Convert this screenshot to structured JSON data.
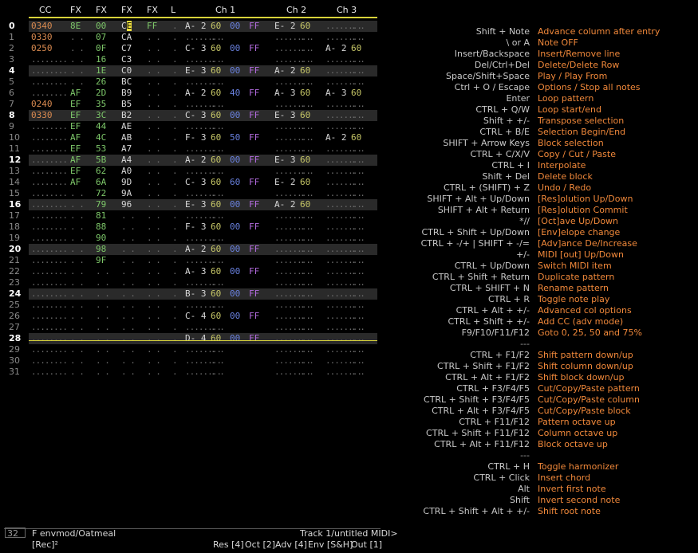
{
  "header": {
    "cc": "CC",
    "fx1": "FX",
    "fx2": "FX",
    "fx3": "FX",
    "fx4": "FX",
    "l": "L",
    "ch1": "Ch 1",
    "ch2": "Ch 2",
    "ch3": "Ch 3"
  },
  "rows": [
    {
      "n": "0",
      "bar": true,
      "cc": "0340",
      "f1": "8E",
      "f2": "00",
      "f3": "CE",
      "f4": "FF",
      "l": ".",
      "n1": "A- 2",
      "v1": "60",
      "p1": "00",
      "d1": "FF",
      "n2": "E- 2",
      "v2": "60",
      "n3": "",
      "v3": ""
    },
    {
      "n": "1",
      "bar": false,
      "cc": "0330",
      "f1": "",
      "f2": "07",
      "f3": "CA",
      "f4": "",
      "l": ".",
      "n1": "",
      "v1": "",
      "p1": "",
      "d1": "",
      "n2": "",
      "v2": "",
      "n3": "",
      "v3": ""
    },
    {
      "n": "2",
      "bar": false,
      "cc": "0250",
      "f1": "",
      "f2": "0F",
      "f3": "C7",
      "f4": "",
      "l": ".",
      "n1": "C- 3",
      "v1": "60",
      "p1": "00",
      "d1": "FF",
      "n2": "",
      "v2": "",
      "n3": "A- 2",
      "v3": "60"
    },
    {
      "n": "3",
      "bar": false,
      "cc": "",
      "f1": "",
      "f2": "16",
      "f3": "C3",
      "f4": "",
      "l": ".",
      "n1": "",
      "v1": "",
      "p1": "",
      "d1": "",
      "n2": "",
      "v2": "",
      "n3": "",
      "v3": ""
    },
    {
      "n": "4",
      "bar": true,
      "cc": "",
      "f1": "",
      "f2": "1E",
      "f3": "C0",
      "f4": "",
      "l": ".",
      "n1": "E- 3",
      "v1": "60",
      "p1": "00",
      "d1": "FF",
      "n2": "A- 2",
      "v2": "60",
      "n3": "",
      "v3": ""
    },
    {
      "n": "5",
      "bar": false,
      "cc": "",
      "f1": "",
      "f2": "26",
      "f3": "BC",
      "f4": "",
      "l": ".",
      "n1": "",
      "v1": "",
      "p1": "",
      "d1": "",
      "n2": "",
      "v2": "",
      "n3": "",
      "v3": ""
    },
    {
      "n": "6",
      "bar": false,
      "cc": "",
      "f1": "AF",
      "f2": "2D",
      "f3": "B9",
      "f4": "",
      "l": ".",
      "n1": "A- 2",
      "v1": "60",
      "p1": "40",
      "d1": "FF",
      "n2": "A- 3",
      "v2": "60",
      "n3": "A- 3",
      "v3": "60"
    },
    {
      "n": "7",
      "bar": false,
      "cc": "0240",
      "f1": "EF",
      "f2": "35",
      "f3": "B5",
      "f4": "",
      "l": ".",
      "n1": "",
      "v1": "",
      "p1": "",
      "d1": "",
      "n2": "",
      "v2": "",
      "n3": "",
      "v3": ""
    },
    {
      "n": "8",
      "bar": true,
      "cc": "0330",
      "f1": "EF",
      "f2": "3C",
      "f3": "B2",
      "f4": "",
      "l": ".",
      "n1": "C- 3",
      "v1": "60",
      "p1": "00",
      "d1": "FF",
      "n2": "E- 3",
      "v2": "60",
      "n3": "",
      "v3": ""
    },
    {
      "n": "9",
      "bar": false,
      "cc": "",
      "f1": "EF",
      "f2": "44",
      "f3": "AE",
      "f4": "",
      "l": ".",
      "n1": "",
      "v1": "",
      "p1": "",
      "d1": "",
      "n2": "",
      "v2": "",
      "n3": "",
      "v3": ""
    },
    {
      "n": "10",
      "bar": false,
      "cc": "",
      "f1": "AF",
      "f2": "4C",
      "f3": "AB",
      "f4": "",
      "l": ".",
      "n1": "F- 3",
      "v1": "60",
      "p1": "50",
      "d1": "FF",
      "n2": "",
      "v2": "",
      "n3": "A- 2",
      "v3": "60"
    },
    {
      "n": "11",
      "bar": false,
      "cc": "",
      "f1": "EF",
      "f2": "53",
      "f3": "A7",
      "f4": "",
      "l": ".",
      "n1": "",
      "v1": "",
      "p1": "",
      "d1": "",
      "n2": "",
      "v2": "",
      "n3": "",
      "v3": ""
    },
    {
      "n": "12",
      "bar": true,
      "cc": "",
      "f1": "AF",
      "f2": "5B",
      "f3": "A4",
      "f4": "",
      "l": ".",
      "n1": "A- 2",
      "v1": "60",
      "p1": "00",
      "d1": "FF",
      "n2": "E- 3",
      "v2": "60",
      "n3": "",
      "v3": ""
    },
    {
      "n": "13",
      "bar": false,
      "cc": "",
      "f1": "EF",
      "f2": "62",
      "f3": "A0",
      "f4": "",
      "l": ".",
      "n1": "",
      "v1": "",
      "p1": "",
      "d1": "",
      "n2": "",
      "v2": "",
      "n3": "",
      "v3": ""
    },
    {
      "n": "14",
      "bar": false,
      "cc": "",
      "f1": "AF",
      "f2": "6A",
      "f3": "9D",
      "f4": "",
      "l": ".",
      "n1": "C- 3",
      "v1": "60",
      "p1": "60",
      "d1": "FF",
      "n2": "E- 2",
      "v2": "60",
      "n3": "",
      "v3": ""
    },
    {
      "n": "15",
      "bar": false,
      "cc": "",
      "f1": "",
      "f2": "72",
      "f3": "9A",
      "f4": "",
      "l": ".",
      "n1": "",
      "v1": "",
      "p1": "",
      "d1": "",
      "n2": "",
      "v2": "",
      "n3": "",
      "v3": ""
    },
    {
      "n": "16",
      "bar": true,
      "cc": "",
      "f1": "",
      "f2": "79",
      "f3": "96",
      "f4": "",
      "l": ".",
      "n1": "E- 3",
      "v1": "60",
      "p1": "00",
      "d1": "FF",
      "n2": "A- 2",
      "v2": "60",
      "n3": "",
      "v3": ""
    },
    {
      "n": "17",
      "bar": false,
      "cc": "",
      "f1": "",
      "f2": "81",
      "f3": "",
      "f4": "",
      "l": ".",
      "n1": "",
      "v1": "",
      "p1": "",
      "d1": "",
      "n2": "",
      "v2": "",
      "n3": "",
      "v3": ""
    },
    {
      "n": "18",
      "bar": false,
      "cc": "",
      "f1": "",
      "f2": "88",
      "f3": "",
      "f4": "",
      "l": ".",
      "n1": "F- 3",
      "v1": "60",
      "p1": "00",
      "d1": "FF",
      "n2": "",
      "v2": "",
      "n3": "",
      "v3": ""
    },
    {
      "n": "19",
      "bar": false,
      "cc": "",
      "f1": "",
      "f2": "90",
      "f3": "",
      "f4": "",
      "l": ".",
      "n1": "",
      "v1": "",
      "p1": "",
      "d1": "",
      "n2": "",
      "v2": "",
      "n3": "",
      "v3": ""
    },
    {
      "n": "20",
      "bar": true,
      "cc": "",
      "f1": "",
      "f2": "98",
      "f3": "",
      "f4": "",
      "l": ".",
      "n1": "A- 2",
      "v1": "60",
      "p1": "00",
      "d1": "FF",
      "n2": "",
      "v2": "",
      "n3": "",
      "v3": ""
    },
    {
      "n": "21",
      "bar": false,
      "cc": "",
      "f1": "",
      "f2": "9F",
      "f3": "",
      "f4": "",
      "l": ".",
      "n1": "",
      "v1": "",
      "p1": "",
      "d1": "",
      "n2": "",
      "v2": "",
      "n3": "",
      "v3": ""
    },
    {
      "n": "22",
      "bar": false,
      "cc": "",
      "f1": "",
      "f2": "",
      "f3": "",
      "f4": "",
      "l": ".",
      "n1": "A- 3",
      "v1": "60",
      "p1": "00",
      "d1": "FF",
      "n2": "",
      "v2": "",
      "n3": "",
      "v3": ""
    },
    {
      "n": "23",
      "bar": false,
      "cc": "",
      "f1": "",
      "f2": "",
      "f3": "",
      "f4": "",
      "l": ".",
      "n1": "",
      "v1": "",
      "p1": "",
      "d1": "",
      "n2": "",
      "v2": "",
      "n3": "",
      "v3": ""
    },
    {
      "n": "24",
      "bar": true,
      "cc": "",
      "f1": "",
      "f2": "",
      "f3": "",
      "f4": "",
      "l": ".",
      "n1": "B- 3",
      "v1": "60",
      "p1": "00",
      "d1": "FF",
      "n2": "",
      "v2": "",
      "n3": "",
      "v3": ""
    },
    {
      "n": "25",
      "bar": false,
      "cc": "",
      "f1": "",
      "f2": "",
      "f3": "",
      "f4": "",
      "l": ".",
      "n1": "",
      "v1": "",
      "p1": "",
      "d1": "",
      "n2": "",
      "v2": "",
      "n3": "",
      "v3": ""
    },
    {
      "n": "26",
      "bar": false,
      "cc": "",
      "f1": "",
      "f2": "",
      "f3": "",
      "f4": "",
      "l": ".",
      "n1": "C- 4",
      "v1": "60",
      "p1": "00",
      "d1": "FF",
      "n2": "",
      "v2": "",
      "n3": "",
      "v3": ""
    },
    {
      "n": "27",
      "bar": false,
      "cc": "",
      "f1": "",
      "f2": "",
      "f3": "",
      "f4": "",
      "l": ".",
      "n1": "",
      "v1": "",
      "p1": "",
      "d1": "",
      "n2": "",
      "v2": "",
      "n3": "",
      "v3": ""
    },
    {
      "n": "28",
      "bar": true,
      "cc": "",
      "f1": "",
      "f2": "",
      "f3": "",
      "f4": "",
      "l": ".",
      "n1": "D- 4",
      "v1": "60",
      "p1": "00",
      "d1": "FF",
      "n2": "",
      "v2": "",
      "n3": "",
      "v3": ""
    },
    {
      "n": "29",
      "bar": false,
      "cc": "",
      "f1": "",
      "f2": "",
      "f3": "",
      "f4": "",
      "l": ".",
      "n1": "",
      "v1": "",
      "p1": "",
      "d1": "",
      "n2": "",
      "v2": "",
      "n3": "",
      "v3": ""
    },
    {
      "n": "30",
      "bar": false,
      "cc": "",
      "f1": "",
      "f2": "",
      "f3": "",
      "f4": "",
      "l": ".",
      "n1": "",
      "v1": "",
      "p1": "",
      "d1": "",
      "n2": "",
      "v2": "",
      "n3": "",
      "v3": ""
    },
    {
      "n": "31",
      "bar": false,
      "cc": "",
      "f1": "",
      "f2": "",
      "f3": "",
      "f4": "",
      "l": ".",
      "n1": "",
      "v1": "",
      "p1": "",
      "d1": "",
      "n2": "",
      "v2": "",
      "n3": "",
      "v3": ""
    }
  ],
  "cursor": {
    "row": "0",
    "field": "f3",
    "text_before": "C",
    "text_hl": "E"
  },
  "footer": {
    "row_count": "32",
    "envelope": "F envmod/Oatmeal",
    "track": "Track 1/untitled MIDI>",
    "rec": "[Rec]²",
    "res": "Res [4]",
    "oct": "Oct [2]",
    "adv": "Adv [4]",
    "env": "Env [S&H]",
    "out": "Out [1]"
  },
  "shortcuts": [
    {
      "k": "Shift + Note",
      "d": "Advance column after entry"
    },
    {
      "k": "\\ or A",
      "d": "Note OFF"
    },
    {
      "k": "Insert/Backspace",
      "d": "Insert/Remove line"
    },
    {
      "k": "Del/Ctrl+Del",
      "d": "Delete/Delete Row"
    },
    {
      "k": "Space/Shift+Space",
      "d": "Play / Play From"
    },
    {
      "k": "Ctrl + O / Escape",
      "d": "Options / Stop all notes"
    },
    {
      "k": "Enter",
      "d": "Loop pattern"
    },
    {
      "k": "CTRL + Q/W",
      "d": "Loop start/end"
    },
    {
      "k": "Shift + +/-",
      "d": "Transpose selection"
    },
    {
      "k": "CTRL + B/E",
      "d": "Selection Begin/End"
    },
    {
      "k": "SHIFT + Arrow Keys",
      "d": "Block selection"
    },
    {
      "k": "CTRL + C/X/V",
      "d": "Copy / Cut / Paste"
    },
    {
      "k": "CTRL + I",
      "d": "Interpolate"
    },
    {
      "k": "Shift + Del",
      "d": "Delete block"
    },
    {
      "k": "CTRL + (SHIFT) + Z",
      "d": "Undo / Redo"
    },
    {
      "k": "SHIFT + Alt + Up/Down",
      "d": "[Res]olution Up/Down"
    },
    {
      "k": "SHIFT + Alt + Return",
      "d": "[Res]olution Commit"
    },
    {
      "k": "*//",
      "d": "[Oct]ave Up/Down"
    },
    {
      "k": "CTRL + Shift + Up/Down",
      "d": "[Env]elope change"
    },
    {
      "k": "CTRL + -/+ | SHIFT + -/=",
      "d": "[Adv]ance De/Increase"
    },
    {
      "k": "+/-",
      "d": "MIDI [out] Up/Down"
    },
    {
      "k": "CTRL + Up/Down",
      "d": "Switch MIDI item"
    },
    {
      "k": "CTRL + Shift + Return",
      "d": "Duplicate pattern"
    },
    {
      "k": "CTRL + SHIFT + N",
      "d": "Rename pattern"
    },
    {
      "k": "CTRL + R",
      "d": "Toggle note play"
    },
    {
      "k": "CTRL + Alt + +/-",
      "d": "Advanced col options"
    },
    {
      "k": "CTRL + Shift + +/-",
      "d": "Add CC (adv mode)"
    },
    {
      "k": "F9/F10/F11/F12",
      "d": "Goto 0, 25, 50 and 75%"
    },
    {
      "k": "---",
      "d": ""
    },
    {
      "k": "CTRL + F1/F2",
      "d": "Shift pattern down/up"
    },
    {
      "k": "CTRL + Shift + F1/F2",
      "d": "Shift column down/up"
    },
    {
      "k": "CTRL + Alt + F1/F2",
      "d": "Shift block down/up"
    },
    {
      "k": "CTRL + F3/F4/F5",
      "d": "Cut/Copy/Paste pattern"
    },
    {
      "k": "CTRL + Shift + F3/F4/F5",
      "d": "Cut/Copy/Paste column"
    },
    {
      "k": "CTRL + Alt + F3/F4/F5",
      "d": "Cut/Copy/Paste block"
    },
    {
      "k": "CTRL + F11/F12",
      "d": "Pattern octave up"
    },
    {
      "k": "CTRL + Shift + F11/F12",
      "d": "Column octave up"
    },
    {
      "k": "CTRL + Alt + F11/F12",
      "d": "Block octave up"
    },
    {
      "k": "---",
      "d": ""
    },
    {
      "k": "CTRL + H",
      "d": "Toggle harmonizer"
    },
    {
      "k": "CTRL + Click",
      "d": "Insert chord"
    },
    {
      "k": "Alt",
      "d": "Invert first note"
    },
    {
      "k": "Shift",
      "d": "Invert second note"
    },
    {
      "k": "CTRL + Shift + Alt + +/-",
      "d": "Shift root note"
    }
  ],
  "colors": {
    "accent": "#d7d23a",
    "shortcut_desc": "#f0883a",
    "cc": "#d98a50",
    "fx": "#7ec86a",
    "vol": "#c8c868",
    "pan": "#6a82e0",
    "dly": "#b46ce0"
  }
}
